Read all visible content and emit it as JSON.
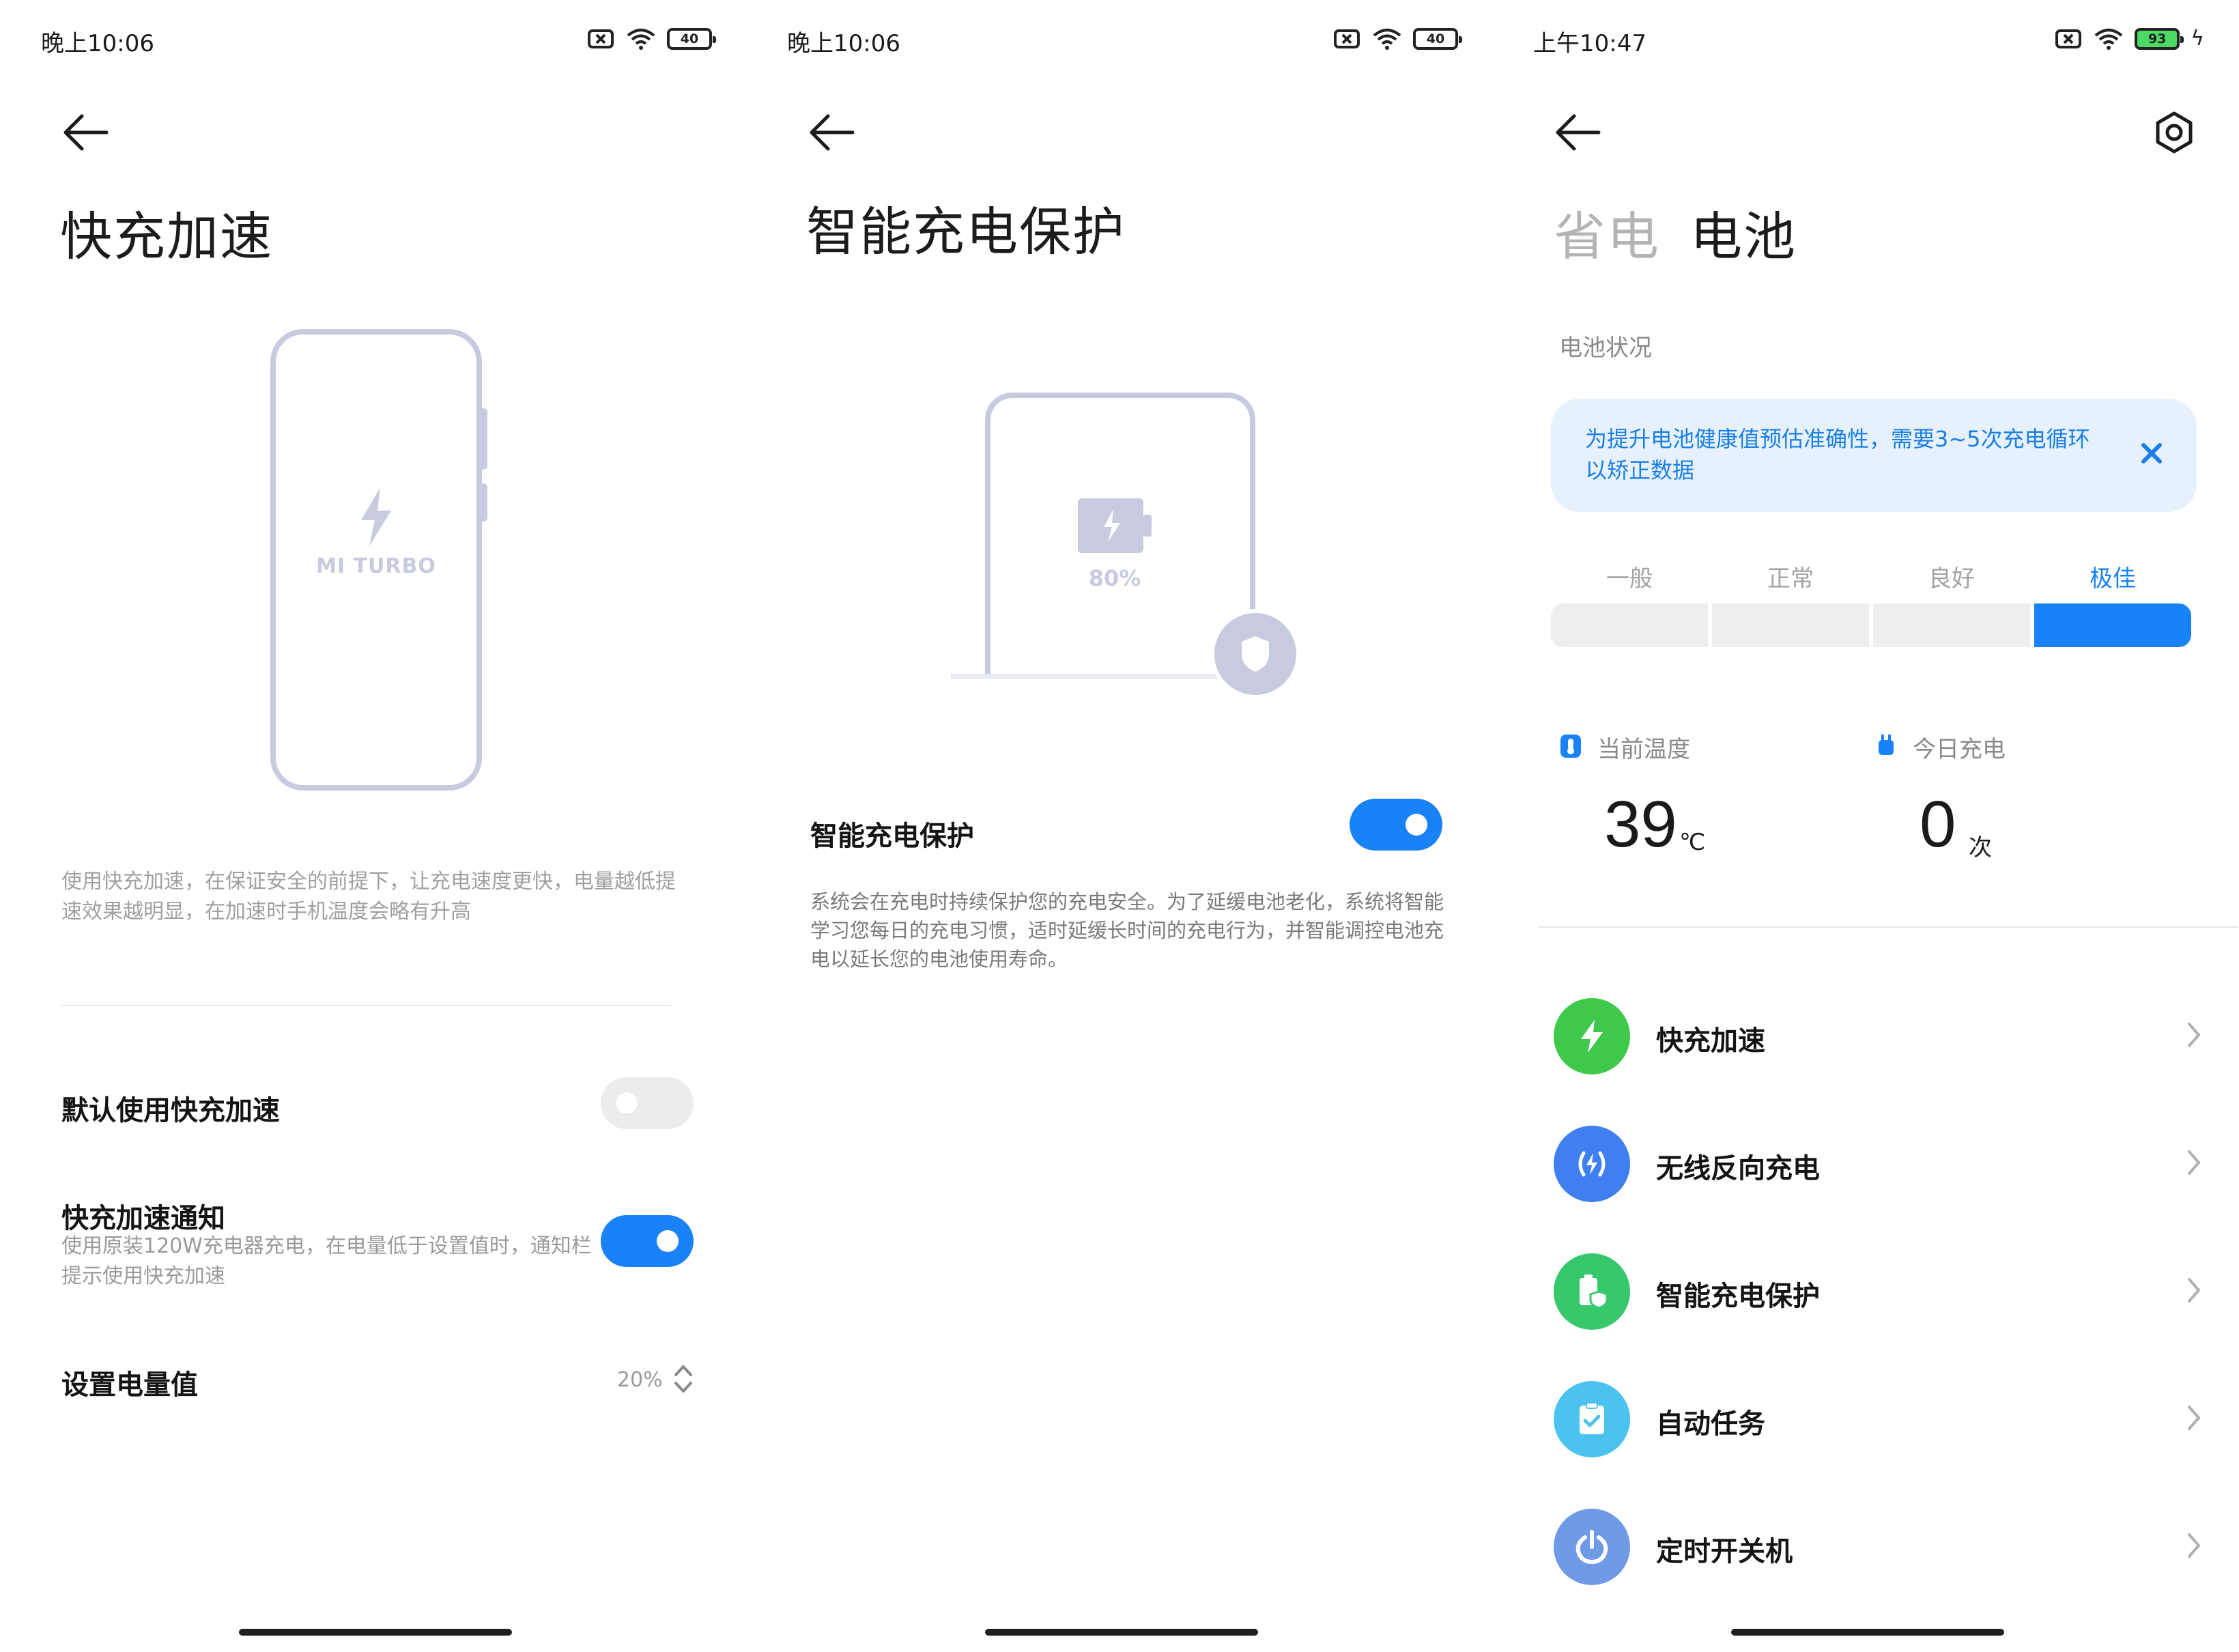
{
  "screen1": {
    "status": {
      "time": "晚上10:06",
      "battery": "40"
    },
    "title": "快充加速",
    "illustration_label": "MI TURBO",
    "description": "使用快充加速，在保证安全的前提下，让充电速度更快，电量越低提速效果越明显，在加速时手机温度会略有升高",
    "default_label": "默认使用快充加速",
    "default_enabled": false,
    "notify_label": "快充加速通知",
    "notify_enabled": true,
    "notify_desc": "使用原装120W充电器充电，在电量低于设置值时，通知栏提示使用快充加速",
    "threshold_label": "设置电量值",
    "threshold_value": "20%"
  },
  "screen2": {
    "status": {
      "time": "晚上10:06",
      "battery": "40"
    },
    "title": "智能充电保护",
    "illustration_percent": "80%",
    "toggle_label": "智能充电保护",
    "toggle_enabled": true,
    "description": "系统会在充电时持续保护您的充电安全。为了延缓电池老化，系统将智能学习您每日的充电习惯，适时延缓长时间的充电行为，并智能调控电池充电以延长您的电池使用寿命。"
  },
  "screen3": {
    "status": {
      "time": "上午10:47",
      "battery": "93"
    },
    "tabs": [
      "省电",
      "电池"
    ],
    "active_tab": "电池",
    "section_label": "电池状况",
    "banner_text": "为提升电池健康值预估准确性，需要3~5次充电循环以矫正数据",
    "health_levels": [
      "一般",
      "正常",
      "良好",
      "极佳"
    ],
    "health_current": "极佳",
    "temperature_label": "当前温度",
    "temperature_value": "39",
    "temperature_unit": "℃",
    "charge_label": "今日充电",
    "charge_value": "0",
    "charge_unit": "次",
    "menu": [
      {
        "label": "快充加速",
        "icon": "bolt-icon",
        "color": "#3fc94a"
      },
      {
        "label": "无线反向充电",
        "icon": "wireless-charge-icon",
        "color": "#3f7ff0"
      },
      {
        "label": "智能充电保护",
        "icon": "battery-shield-icon",
        "color": "#36c86a"
      },
      {
        "label": "自动任务",
        "icon": "clipboard-check-icon",
        "color": "#4cc3ef"
      },
      {
        "label": "定时开关机",
        "icon": "power-icon",
        "color": "#6f9ae6"
      }
    ]
  },
  "colors": {
    "accent": "#1a82f7",
    "illustration": "#c8cbe0"
  }
}
